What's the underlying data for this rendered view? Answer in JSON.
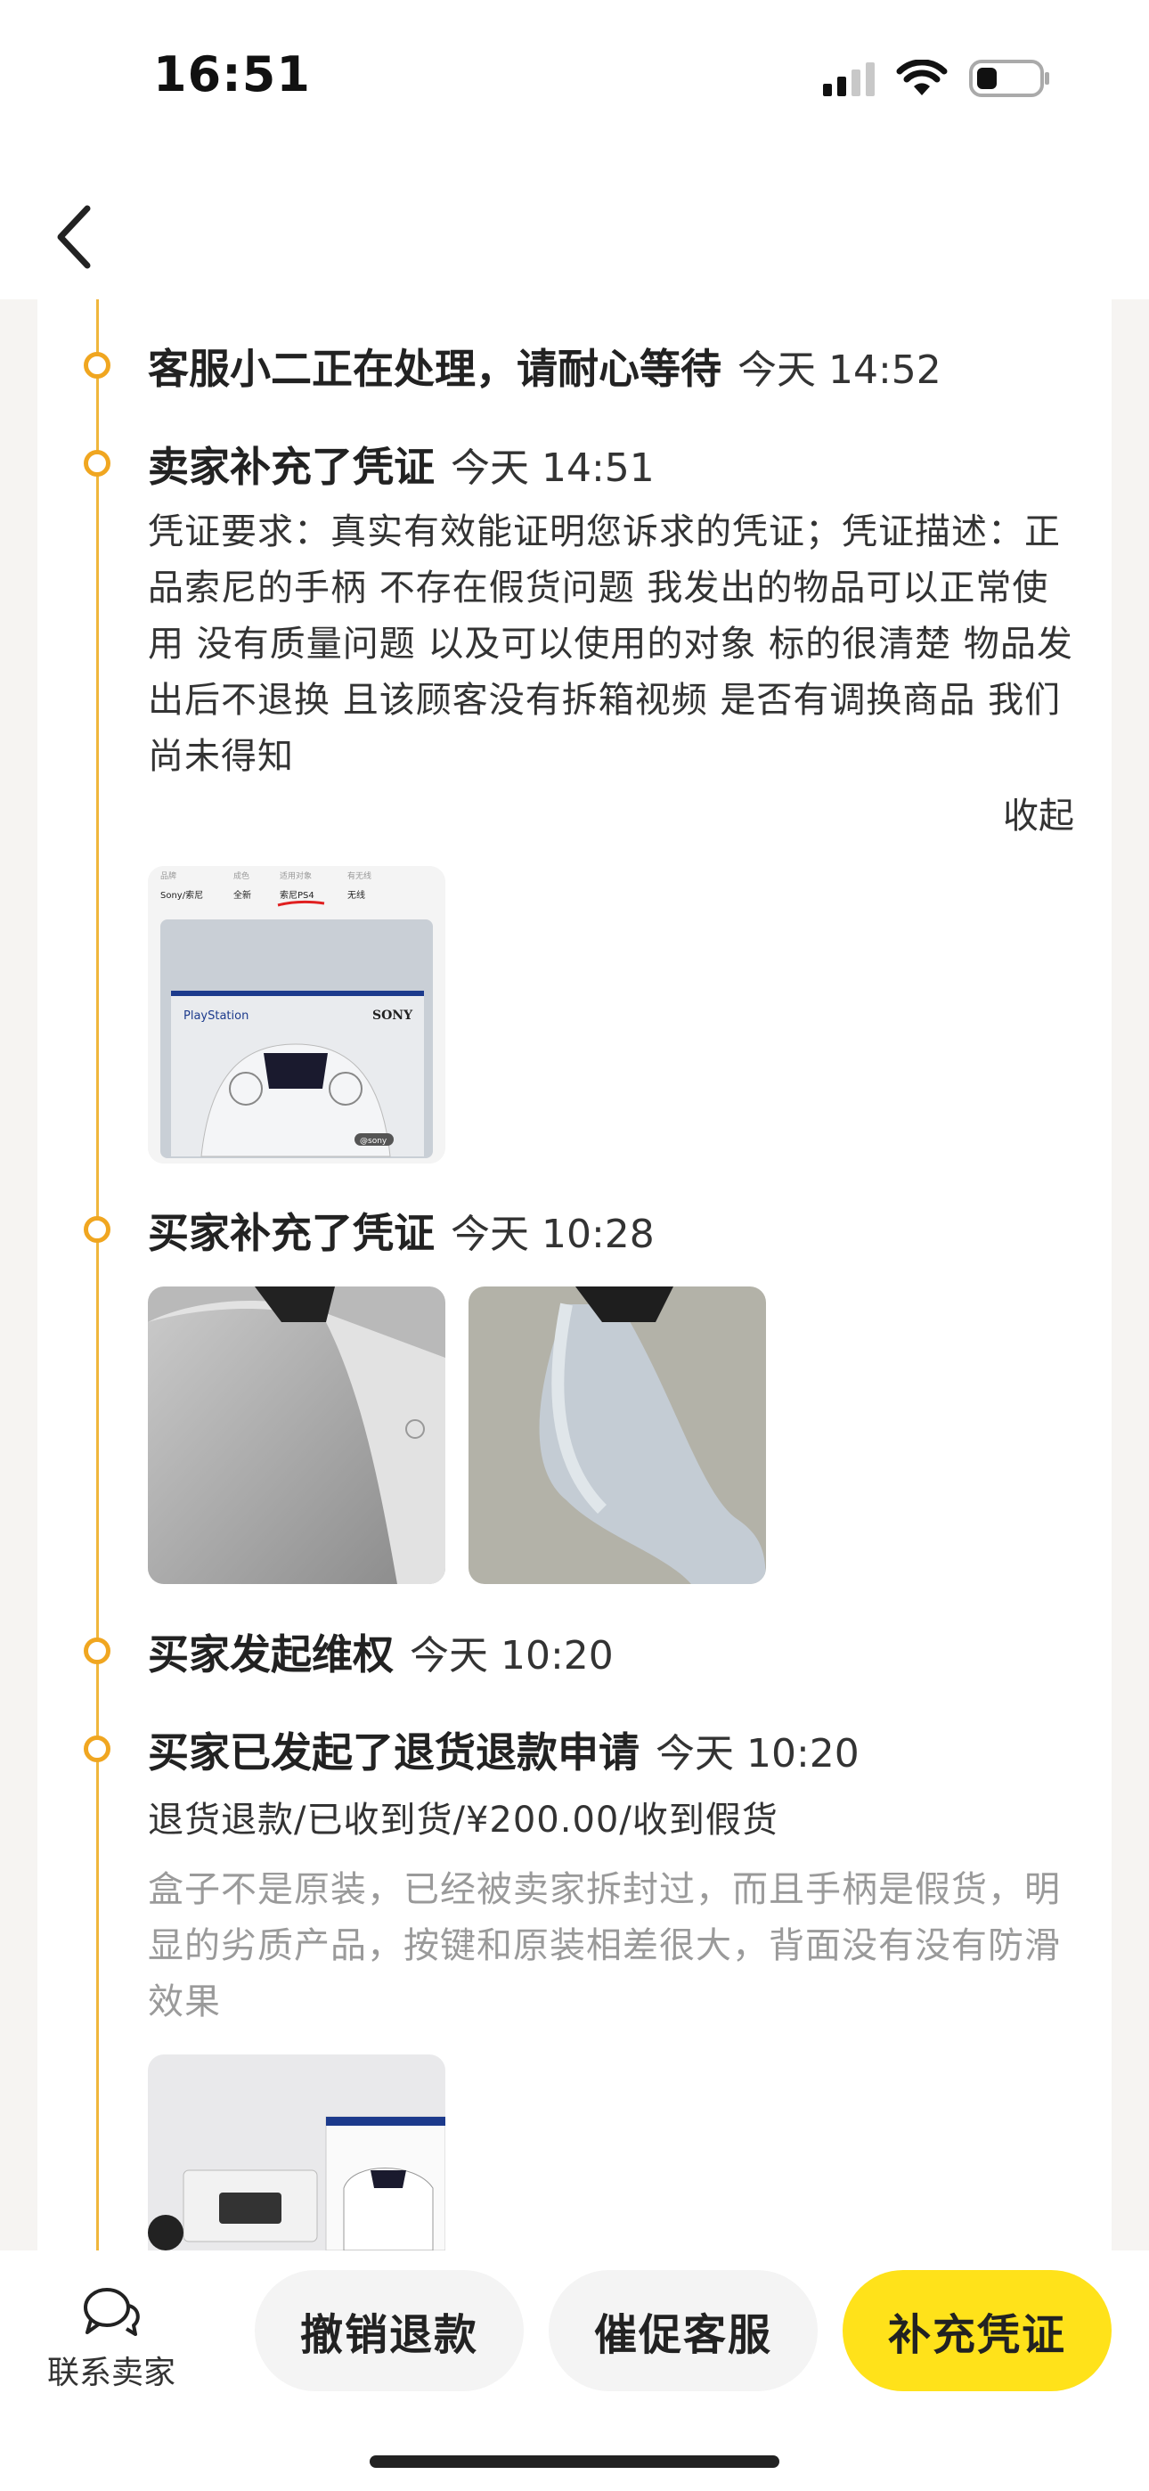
{
  "status_bar": {
    "time": "16:51"
  },
  "events": [
    {
      "title": "客服小二正在处理，请耐心等待",
      "time": "今天 14:52"
    },
    {
      "title": "卖家补充了凭证",
      "time": "今天 14:51",
      "description": "凭证要求：真实有效能证明您诉求的凭证；凭证描述：正品索尼的手柄 不存在假货问题 我发出的物品可以正常使用 没有质量问题 以及可以使用的对象 标的很清楚 物品发出后不退换 且该顾客没有拆箱视频 是否有调换商品 我们尚未得知",
      "collapse_label": "收起",
      "image_label": {
        "attr_headers": [
          "品牌",
          "成色",
          "适用对象",
          "有无线"
        ],
        "attr_values": [
          "Sony/索尼",
          "全新",
          "索尼PS4",
          "无线"
        ],
        "brand_left": "PlayStation",
        "brand_right": "SONY",
        "tag": "@sony"
      }
    },
    {
      "title": "买家补充了凭证",
      "time": "今天 10:28"
    },
    {
      "title": "买家发起维权",
      "time": "今天 10:20"
    },
    {
      "title": "买家已发起了退货退款申请",
      "time": "今天 10:20",
      "summary": "退货退款/已收到货/¥200.00/收到假货",
      "reason": "盒子不是原装，已经被卖家拆封过，而且手柄是假货，明显的劣质产品，按键和原装相差很大，背面没有没有防滑效果"
    }
  ],
  "bottom_bar": {
    "contact_label": "联系卖家",
    "cancel_label": "撤销退款",
    "urge_label": "催促客服",
    "supplement_label": "补充凭证"
  },
  "colors": {
    "accent": "#ffe21a",
    "timeline": "#f0a620"
  }
}
